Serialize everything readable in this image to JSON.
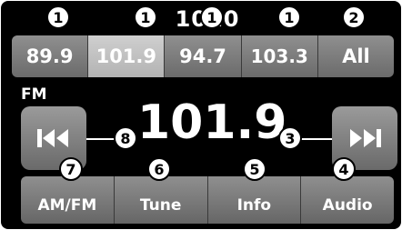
{
  "clock": "1010",
  "presets": [
    {
      "label": "89.9",
      "active": false
    },
    {
      "label": "101.9",
      "active": true
    },
    {
      "label": "94.7",
      "active": false
    },
    {
      "label": "103.3",
      "active": false
    },
    {
      "label": "All",
      "active": false
    }
  ],
  "band": "FM",
  "frequency": "101.9",
  "seek": {
    "prev_icon": "seek-back-icon",
    "next_icon": "seek-forward-icon"
  },
  "bottom_buttons": [
    {
      "label": "AM/FM"
    },
    {
      "label": "Tune"
    },
    {
      "label": "Info"
    },
    {
      "label": "Audio"
    }
  ],
  "callouts": [
    "1",
    "1",
    "1",
    "1",
    "2",
    "3",
    "4",
    "5",
    "6",
    "7",
    "8"
  ]
}
